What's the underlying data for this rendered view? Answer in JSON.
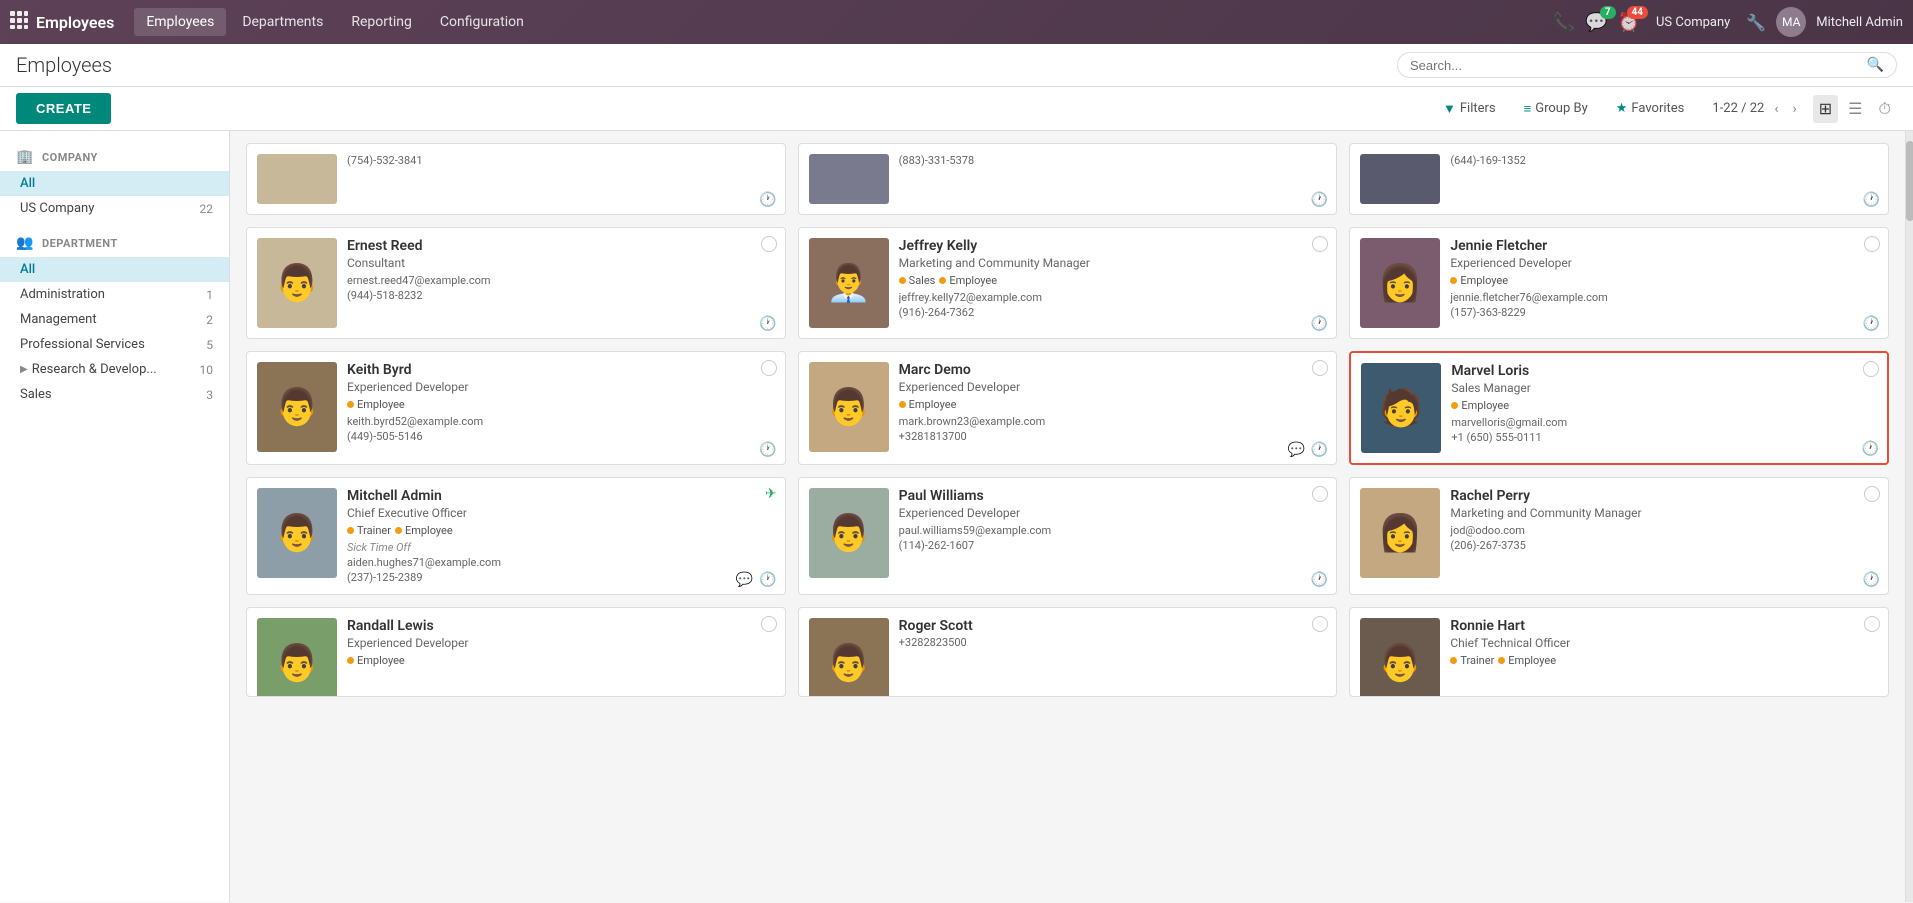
{
  "app": {
    "name": "Employees",
    "nav_links": [
      "Employees",
      "Departments",
      "Reporting",
      "Configuration"
    ],
    "active_nav": "Employees"
  },
  "header": {
    "title": "Employees",
    "search_placeholder": "Search..."
  },
  "toolbar": {
    "create_label": "CREATE",
    "filters_label": "Filters",
    "groupby_label": "Group By",
    "favorites_label": "Favorites",
    "pager": "1-22 / 22"
  },
  "topbar": {
    "company": "US Company",
    "admin": "Mitchell Admin",
    "messages_count": "7",
    "alerts_count": "44"
  },
  "sidebar": {
    "company_section": "COMPANY",
    "company_items": [
      {
        "label": "All",
        "count": "",
        "active": true
      },
      {
        "label": "US Company",
        "count": "22",
        "active": false
      }
    ],
    "department_section": "DEPARTMENT",
    "department_items": [
      {
        "label": "All",
        "count": "",
        "active": true
      },
      {
        "label": "Administration",
        "count": "1",
        "active": false
      },
      {
        "label": "Management",
        "count": "2",
        "active": false
      },
      {
        "label": "Professional Services",
        "count": "5",
        "active": false
      },
      {
        "label": "Research & Develop...",
        "count": "10",
        "active": false,
        "expandable": true
      },
      {
        "label": "Sales",
        "count": "3",
        "active": false
      }
    ]
  },
  "employees": [
    {
      "id": "partial1",
      "partial": true,
      "phone": "(754)-532-3841"
    },
    {
      "id": "partial2",
      "partial": true,
      "phone": "(883)-331-5378"
    },
    {
      "id": "partial3",
      "partial": true,
      "phone": "(644)-169-1352"
    },
    {
      "id": "ernest-reed",
      "name": "Ernest Reed",
      "title": "Consultant",
      "tags": [],
      "email": "ernest.reed47@example.com",
      "phone": "(944)-518-8232",
      "photo_color": "#c8b89a",
      "photo_emoji": "👨"
    },
    {
      "id": "jeffrey-kelly",
      "name": "Jeffrey Kelly",
      "title": "Marketing and Community Manager",
      "tags": [
        "Sales",
        "Employee"
      ],
      "email": "jeffrey.kelly72@example.com",
      "phone": "(916)-264-7362",
      "photo_color": "#8b6f5e",
      "photo_emoji": "👨‍💼"
    },
    {
      "id": "jennie-fletcher",
      "name": "Jennie Fletcher",
      "title": "Experienced Developer",
      "tags": [
        "Employee"
      ],
      "email": "jennie.fletcher76@example.com",
      "phone": "(157)-363-8229",
      "photo_color": "#7a5c6e",
      "photo_emoji": "👩"
    },
    {
      "id": "keith-byrd",
      "name": "Keith Byrd",
      "title": "Experienced Developer",
      "tags": [
        "Employee"
      ],
      "email": "keith.byrd52@example.com",
      "phone": "(449)-505-5146",
      "photo_color": "#8b7355",
      "photo_emoji": "👨"
    },
    {
      "id": "marc-demo",
      "name": "Marc Demo",
      "title": "Experienced Developer",
      "tags": [
        "Employee"
      ],
      "email": "mark.brown23@example.com",
      "phone": "+3281813700",
      "photo_color": "#c4a882",
      "photo_emoji": "👨"
    },
    {
      "id": "marvel-loris",
      "name": "Marvel Loris",
      "title": "Sales Manager",
      "tags": [
        "Employee"
      ],
      "email": "marvelloris@gmail.com",
      "phone": "+1 (650) 555-0111",
      "photo_color": "#3d5a6e",
      "photo_emoji": "🧑",
      "highlighted": true
    },
    {
      "id": "mitchell-admin",
      "name": "Mitchell Admin",
      "title": "Chief Executive Officer",
      "tags": [
        "Trainer",
        "Employee"
      ],
      "extra": "Sick Time Off",
      "email": "aiden.hughes71@example.com",
      "phone": "(237)-125-2389",
      "photo_color": "#8e9ea8",
      "photo_emoji": "👨",
      "has_chat": true,
      "has_plane": true
    },
    {
      "id": "paul-williams",
      "name": "Paul Williams",
      "title": "Experienced Developer",
      "tags": [],
      "email": "paul.williams59@example.com",
      "phone": "(114)-262-1607",
      "photo_color": "#9aada0",
      "photo_emoji": "👨"
    },
    {
      "id": "rachel-perry",
      "name": "Rachel Perry",
      "title": "Marketing and Community Manager",
      "tags": [],
      "email": "jod@odoo.com",
      "phone": "(206)-267-3735",
      "photo_color": "#c4a882",
      "photo_emoji": "👩"
    },
    {
      "id": "randall-lewis",
      "name": "Randall Lewis",
      "title": "Experienced Developer",
      "tags": [
        "Employee"
      ],
      "email": "",
      "phone": "",
      "photo_color": "#7a9e6a",
      "photo_emoji": "👨",
      "partial_bottom": true
    },
    {
      "id": "roger-scott",
      "name": "Roger Scott",
      "title": "",
      "tags": [],
      "email": "",
      "phone": "+3282823500",
      "photo_color": "#8b7355",
      "photo_emoji": "👨",
      "partial_bottom": true
    },
    {
      "id": "ronnie-hart",
      "name": "Ronnie Hart",
      "title": "Chief Technical Officer",
      "tags": [
        "Trainer",
        "Employee"
      ],
      "email": "",
      "phone": "",
      "photo_color": "#6b5a4e",
      "photo_emoji": "👨",
      "partial_bottom": true
    }
  ]
}
